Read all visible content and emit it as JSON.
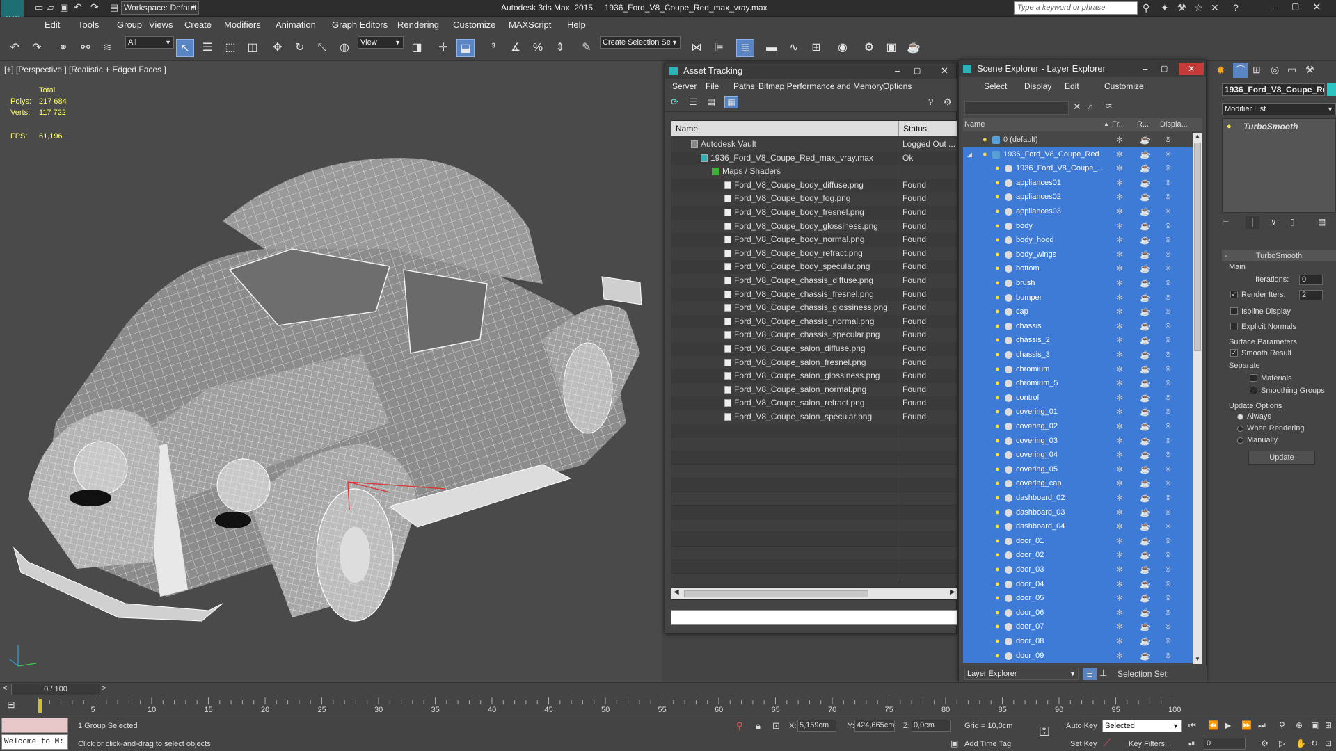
{
  "title_bar": {
    "app_title": "Autodesk 3ds Max  2015     1936_Ford_V8_Coupe_Red_max_vray.max",
    "workspace": "Workspace: Default",
    "search_placeholder": "Type a keyword or phrase",
    "logo": "MAX"
  },
  "menu": [
    "Edit",
    "Tools",
    "Group",
    "Views",
    "Create",
    "Modifiers",
    "Animation",
    "Graph Editors",
    "Rendering",
    "Customize",
    "MAXScript",
    "Help"
  ],
  "toolbar": {
    "filter": "All",
    "ref_coord": "View",
    "selection_set": "Create Selection Se"
  },
  "viewport": {
    "label": "[+] [Perspective ] [Realistic + Edged Faces ]",
    "stats_header": "Total",
    "polys_label": "Polys:",
    "polys_value": "217 684",
    "verts_label": "Verts:",
    "verts_value": "117 722",
    "fps_label": "FPS:",
    "fps_value": "61,196"
  },
  "asset_tracking": {
    "title": "Asset Tracking",
    "menu": [
      "Server",
      "File",
      "Paths",
      "Bitmap Performance and Memory",
      "Options"
    ],
    "columns": [
      "Name",
      "Status"
    ],
    "vault": {
      "name": "Autodesk Vault",
      "status": "Logged Out ..."
    },
    "scene_file": {
      "name": "1936_Ford_V8_Coupe_Red_max_vray.max",
      "status": "Ok"
    },
    "folder": "Maps / Shaders",
    "files": [
      {
        "name": "Ford_V8_Coupe_body_diffuse.png",
        "status": "Found"
      },
      {
        "name": "Ford_V8_Coupe_body_fog.png",
        "status": "Found"
      },
      {
        "name": "Ford_V8_Coupe_body_fresnel.png",
        "status": "Found"
      },
      {
        "name": "Ford_V8_Coupe_body_glossiness.png",
        "status": "Found"
      },
      {
        "name": "Ford_V8_Coupe_body_normal.png",
        "status": "Found"
      },
      {
        "name": "Ford_V8_Coupe_body_refract.png",
        "status": "Found"
      },
      {
        "name": "Ford_V8_Coupe_body_specular.png",
        "status": "Found"
      },
      {
        "name": "Ford_V8_Coupe_chassis_diffuse.png",
        "status": "Found"
      },
      {
        "name": "Ford_V8_Coupe_chassis_fresnel.png",
        "status": "Found"
      },
      {
        "name": "Ford_V8_Coupe_chassis_glossiness.png",
        "status": "Found"
      },
      {
        "name": "Ford_V8_Coupe_chassis_normal.png",
        "status": "Found"
      },
      {
        "name": "Ford_V8_Coupe_chassis_specular.png",
        "status": "Found"
      },
      {
        "name": "Ford_V8_Coupe_salon_diffuse.png",
        "status": "Found"
      },
      {
        "name": "Ford_V8_Coupe_salon_fresnel.png",
        "status": "Found"
      },
      {
        "name": "Ford_V8_Coupe_salon_glossiness.png",
        "status": "Found"
      },
      {
        "name": "Ford_V8_Coupe_salon_normal.png",
        "status": "Found"
      },
      {
        "name": "Ford_V8_Coupe_salon_refract.png",
        "status": "Found"
      },
      {
        "name": "Ford_V8_Coupe_salon_specular.png",
        "status": "Found"
      }
    ]
  },
  "scene_explorer": {
    "title": "Scene Explorer - Layer Explorer",
    "menu": [
      "Select",
      "Display",
      "Edit",
      "Customize"
    ],
    "columns": [
      "Name",
      "Fr...",
      "R...",
      "Displa..."
    ],
    "layers": [
      {
        "name": "0 (default)"
      },
      {
        "name": "1936_Ford_V8_Coupe_Red"
      }
    ],
    "objects": [
      "1936_Ford_V8_Coupe_...",
      "appliances01",
      "appliances02",
      "appliances03",
      "body",
      "body_hood",
      "body_wings",
      "bottom",
      "brush",
      "bumper",
      "cap",
      "chassis",
      "chassis_2",
      "chassis_3",
      "chromium",
      "chromium_5",
      "control",
      "covering_01",
      "covering_02",
      "covering_03",
      "covering_04",
      "covering_05",
      "covering_cap",
      "dashboard_02",
      "dashboard_03",
      "dashboard_04",
      "door_01",
      "door_02",
      "door_03",
      "door_04",
      "door_05",
      "door_06",
      "door_07",
      "door_08",
      "door_09"
    ],
    "footer_label": "Layer Explorer",
    "selection_set_label": "Selection Set:"
  },
  "command_panel": {
    "object_name": "1936_Ford_V8_Coupe_Re",
    "modifier_list": "Modifier List",
    "stack_item": "TurboSmooth",
    "rollout_title": "TurboSmooth",
    "main_label": "Main",
    "iterations_label": "Iterations:",
    "iterations_value": "0",
    "render_iters_label": "Render Iters:",
    "render_iters_value": "2",
    "isoline_label": "Isoline Display",
    "explicit_normals_label": "Explicit Normals",
    "surface_params_label": "Surface Parameters",
    "smooth_result_label": "Smooth Result",
    "separate_label": "Separate",
    "materials_label": "Materials",
    "smoothing_groups_label": "Smoothing Groups",
    "update_options_label": "Update Options",
    "always_label": "Always",
    "when_rendering_label": "When Rendering",
    "manually_label": "Manually",
    "update_button": "Update"
  },
  "timeline": {
    "frame_counter": "0 / 100",
    "ticks": [
      "5",
      "10",
      "15",
      "20",
      "25",
      "30",
      "35",
      "40",
      "45",
      "50",
      "55",
      "60",
      "65",
      "70",
      "75",
      "80",
      "85",
      "90",
      "95",
      "100"
    ]
  },
  "status": {
    "maxscript": "Welcome to M:",
    "selected": "1 Group Selected",
    "prompt": "Click or click-and-drag to select objects",
    "x_label": "X:",
    "x_value": "5,159cm",
    "y_label": "Y:",
    "y_value": "424,665cm",
    "z_label": "Z:",
    "z_value": "0,0cm",
    "grid": "Grid = 10,0cm",
    "add_time_tag": "Add Time Tag",
    "auto_key": "Auto Key",
    "key_mode": "Selected",
    "set_key": "Set Key",
    "key_filters": "Key Filters...",
    "frame": "0"
  }
}
